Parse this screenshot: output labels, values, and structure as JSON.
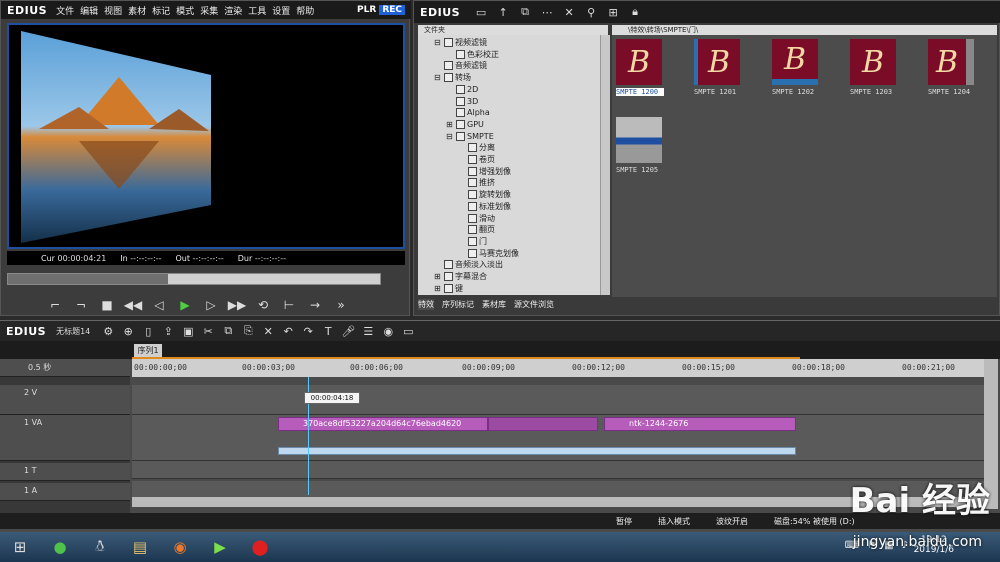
{
  "player": {
    "logo": "EDIUS",
    "menu": [
      "文件",
      "编辑",
      "视图",
      "素材",
      "标记",
      "模式",
      "采集",
      "渲染",
      "工具",
      "设置",
      "帮助"
    ],
    "plr": "PLR",
    "rec": "REC",
    "cur_label": "Cur",
    "cur_value": "00:00:04:21",
    "in_label": "In",
    "in_value": "--:--:--:--",
    "out_label": "Out",
    "out_value": "--:--:--:--",
    "dur_label": "Dur",
    "dur_value": "--:--:--:--",
    "scrub_progress": 0.43
  },
  "library": {
    "logo": "EDIUS",
    "folder_header": "文件夹",
    "path": "\\特效\\转场\\SMPTE\\门\\",
    "tree": [
      {
        "label": "视频滤镜",
        "level": 1,
        "expander": "⊟"
      },
      {
        "label": "色彩校正",
        "level": 2,
        "expander": ""
      },
      {
        "label": "音频滤镜",
        "level": 1,
        "expander": ""
      },
      {
        "label": "转场",
        "level": 1,
        "expander": "⊟"
      },
      {
        "label": "2D",
        "level": 2,
        "expander": ""
      },
      {
        "label": "3D",
        "level": 2,
        "expander": ""
      },
      {
        "label": "Alpha",
        "level": 2,
        "expander": ""
      },
      {
        "label": "GPU",
        "level": 2,
        "expander": "⊞"
      },
      {
        "label": "SMPTE",
        "level": 2,
        "expander": "⊟"
      },
      {
        "label": "分离",
        "level": 3,
        "expander": ""
      },
      {
        "label": "卷页",
        "level": 3,
        "expander": ""
      },
      {
        "label": "增强划像",
        "level": 3,
        "expander": ""
      },
      {
        "label": "推挤",
        "level": 3,
        "expander": ""
      },
      {
        "label": "旋转划像",
        "level": 3,
        "expander": ""
      },
      {
        "label": "标准划像",
        "level": 3,
        "expander": ""
      },
      {
        "label": "滑动",
        "level": 3,
        "expander": ""
      },
      {
        "label": "翻页",
        "level": 3,
        "expander": ""
      },
      {
        "label": "门",
        "level": 3,
        "expander": ""
      },
      {
        "label": "马赛克划像",
        "level": 3,
        "expander": ""
      },
      {
        "label": "音频淡入淡出",
        "level": 1,
        "expander": ""
      },
      {
        "label": "字幕混合",
        "level": 1,
        "expander": "⊞"
      },
      {
        "label": "键",
        "level": 1,
        "expander": "⊞"
      }
    ],
    "tabs": [
      "特效",
      "序列标记",
      "素材库",
      "源文件浏览"
    ],
    "thumbnails": [
      "SMPTE 1200",
      "SMPTE 1201",
      "SMPTE 1202",
      "SMPTE 1203",
      "SMPTE 1204",
      "SMPTE 1205"
    ],
    "thumb_letter": "B"
  },
  "timeline": {
    "logo": "EDIUS",
    "title": "无标题14",
    "sequence_tab": "序列1",
    "zoom": "0.5 秒",
    "ruler_ticks": [
      "00:00:00;00",
      "00:00:03;00",
      "00:00:06;00",
      "00:00:09;00",
      "00:00:12;00",
      "00:00:15;00",
      "00:00:18;00",
      "00:00:21;00"
    ],
    "tracks": [
      {
        "name": "2 V"
      },
      {
        "name": "1 VA"
      },
      {
        "name": "1 T"
      },
      {
        "name": "1 A"
      }
    ],
    "clip1": "370ace8df53227a204d64c76ebad4620",
    "clip2": "ntk-1244-2676",
    "timecode_popup": "00:00:04:18"
  },
  "status": {
    "pause": "暂停",
    "insert_mode": "插入模式",
    "ripple": "波纹开启",
    "disk": "磁盘:54% 被使用 (D:)"
  },
  "taskbar": {
    "time": "19:12",
    "date": "2019/1/6"
  },
  "watermark": {
    "brand": "Bai 经验",
    "url": "jingyan.baidu.com"
  }
}
